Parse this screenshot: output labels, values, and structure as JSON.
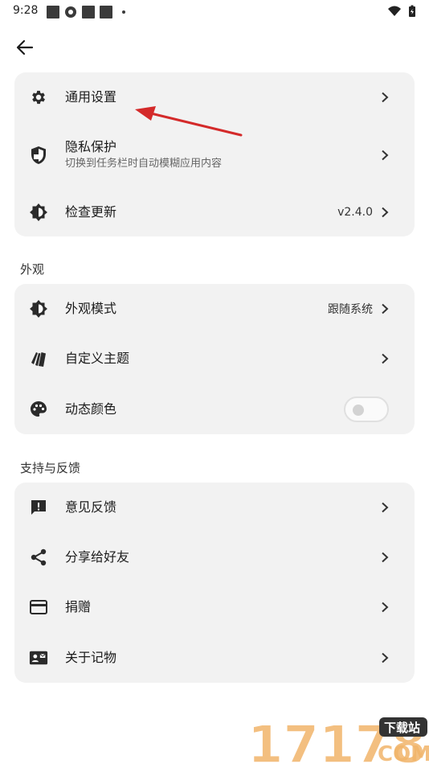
{
  "status_bar": {
    "time": "9:28"
  },
  "general_card": {
    "rows": [
      {
        "title": "通用设置",
        "icon": "gear-icon"
      },
      {
        "title": "隐私保护",
        "subtitle": "切换到任务栏时自动模糊应用内容",
        "icon": "shield-icon"
      },
      {
        "title": "检查更新",
        "value": "v2.4.0",
        "icon": "brightness-icon"
      }
    ]
  },
  "appearance": {
    "section_title": "外观",
    "rows": [
      {
        "title": "外观模式",
        "value": "跟随系统",
        "icon": "brightness-icon"
      },
      {
        "title": "自定义主题",
        "icon": "cards-icon"
      },
      {
        "title": "动态颜色",
        "icon": "palette-icon",
        "toggle_on": false
      }
    ]
  },
  "support": {
    "section_title": "支持与反馈",
    "rows": [
      {
        "title": "意见反馈",
        "icon": "feedback-icon"
      },
      {
        "title": "分享给好友",
        "icon": "share-icon"
      },
      {
        "title": "捐赠",
        "icon": "credit-card-icon"
      },
      {
        "title": "关于记物",
        "icon": "contact-card-icon"
      }
    ]
  },
  "watermark": {
    "number": "17178",
    "badge": "下载站",
    "suffix": "COM"
  },
  "colors": {
    "card_bg": "#f2f2f2",
    "icon": "#2b2b2b",
    "annotation_arrow": "#d42a2a"
  }
}
